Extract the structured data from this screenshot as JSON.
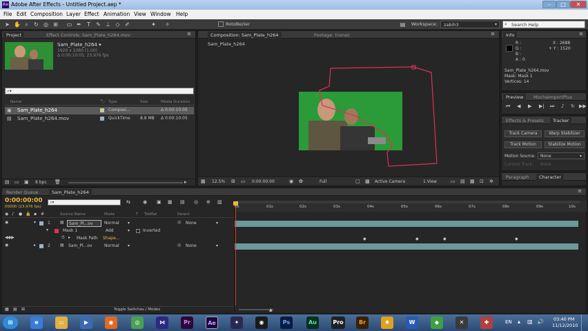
{
  "window": {
    "title": "Adobe After Effects - Untitled Project.aep *"
  },
  "menu": [
    "File",
    "Edit",
    "Composition",
    "Layer",
    "Effect",
    "Animation",
    "View",
    "Window",
    "Help"
  ],
  "toolbar": {
    "roto_label": "RotoBezier",
    "workspace_label": "Workspace:",
    "workspace_value": "zabih3",
    "search_placeholder": "Search Help"
  },
  "project_panel": {
    "tab": "Project",
    "effect_tab": "Effect Controls: Sam_Plate_h264.mov",
    "item_name": "Sam_Plate_h264 ▾",
    "item_info": "1920 x 1080 (1.00)",
    "item_duration": "Δ 0:00:10:05, 23.976 fps",
    "columns": {
      "name": "Name",
      "type": "Type",
      "size": "Size",
      "media_duration": "Media Duration"
    },
    "items": [
      {
        "name": "Sam_Plate_h264",
        "type": "Composi...",
        "size": "",
        "duration": "Δ 0:00:10:05"
      },
      {
        "name": "Sam_Plate_h264.mov",
        "type": "QuickTime",
        "size": "8.8 MB",
        "duration": "Δ 0:00:10:05"
      }
    ],
    "bpc": "8 bpc"
  },
  "comp_panel": {
    "tab": "Composition: Sam_Plate_h264",
    "footage_tab": "Footage: (none)",
    "subtab": "Sam_Plate_h264",
    "zoom": "12.5%",
    "timecode": "0:00:00:00",
    "resolution": "Full",
    "camera": "Active Camera",
    "view": "1 View"
  },
  "info_panel": {
    "tab": "Info",
    "r": "R :",
    "g": "G :",
    "b": "B :",
    "a": "A : 0",
    "x": "X : 2688",
    "y": "+ Y : 1520",
    "layer": "Sam_Plate_h264.mov",
    "mask": "Mask: Mask 1",
    "vertices": "Vertices: 14"
  },
  "preview_panel": {
    "tab": "Preview",
    "import_tab": "MochaImportPlus"
  },
  "tracker_panel": {
    "tab1": "Effects & Presets",
    "tab2": "Tracker",
    "buttons": [
      "Track Camera",
      "Warp Stabilizer",
      "Track Motion",
      "Stabilize Motion"
    ],
    "motion_source_label": "Motion Source:",
    "motion_source_value": "None",
    "current_track_label": "Current Track:",
    "current_track_value": "None"
  },
  "paragraph_panel": {
    "tab1": "Paragraph",
    "tab2": "Character"
  },
  "timeline": {
    "tab_render": "Render Queue",
    "tab_comp": "Sam_Plate_h264",
    "timecode": "0:00:00:00",
    "timecode_sub": "00000 (23.976 fps)",
    "columns": {
      "source_name": "Source Name",
      "mode": "Mode",
      "t": "T",
      "trkmat": "TrkMat",
      "parent": "Parent"
    },
    "layers": [
      {
        "num": "1",
        "name": "Sam_Pl...ov",
        "mode": "Normal",
        "parent": "None"
      },
      {
        "num": "2",
        "name": "Sam_Pl...ov",
        "mode": "Normal",
        "parent": "None"
      }
    ],
    "mask_name": "Mask 1",
    "mask_mode": "Add",
    "mask_inverted": "Inverted",
    "mask_path_label": "Mask Path",
    "mask_path_value": "Shape...",
    "ruler": [
      "0s",
      "01s",
      "02s",
      "03s",
      "04s",
      "05s",
      "06s",
      "07s",
      "08s",
      "09s",
      "10s"
    ],
    "toggle_label": "Toggle Switches / Modes"
  },
  "taskbar": {
    "apps": [
      "Pr",
      "Ae",
      "Ps",
      "Au",
      "Pro",
      "Br",
      "W"
    ],
    "lang": "EN",
    "time": "03:40 PM",
    "date": "11/12/2010"
  },
  "colors": {
    "mask": "#e0305a",
    "timeline_bar": "#6a9a9a",
    "accent": "#e8b84a",
    "playhead": "#d83030"
  }
}
